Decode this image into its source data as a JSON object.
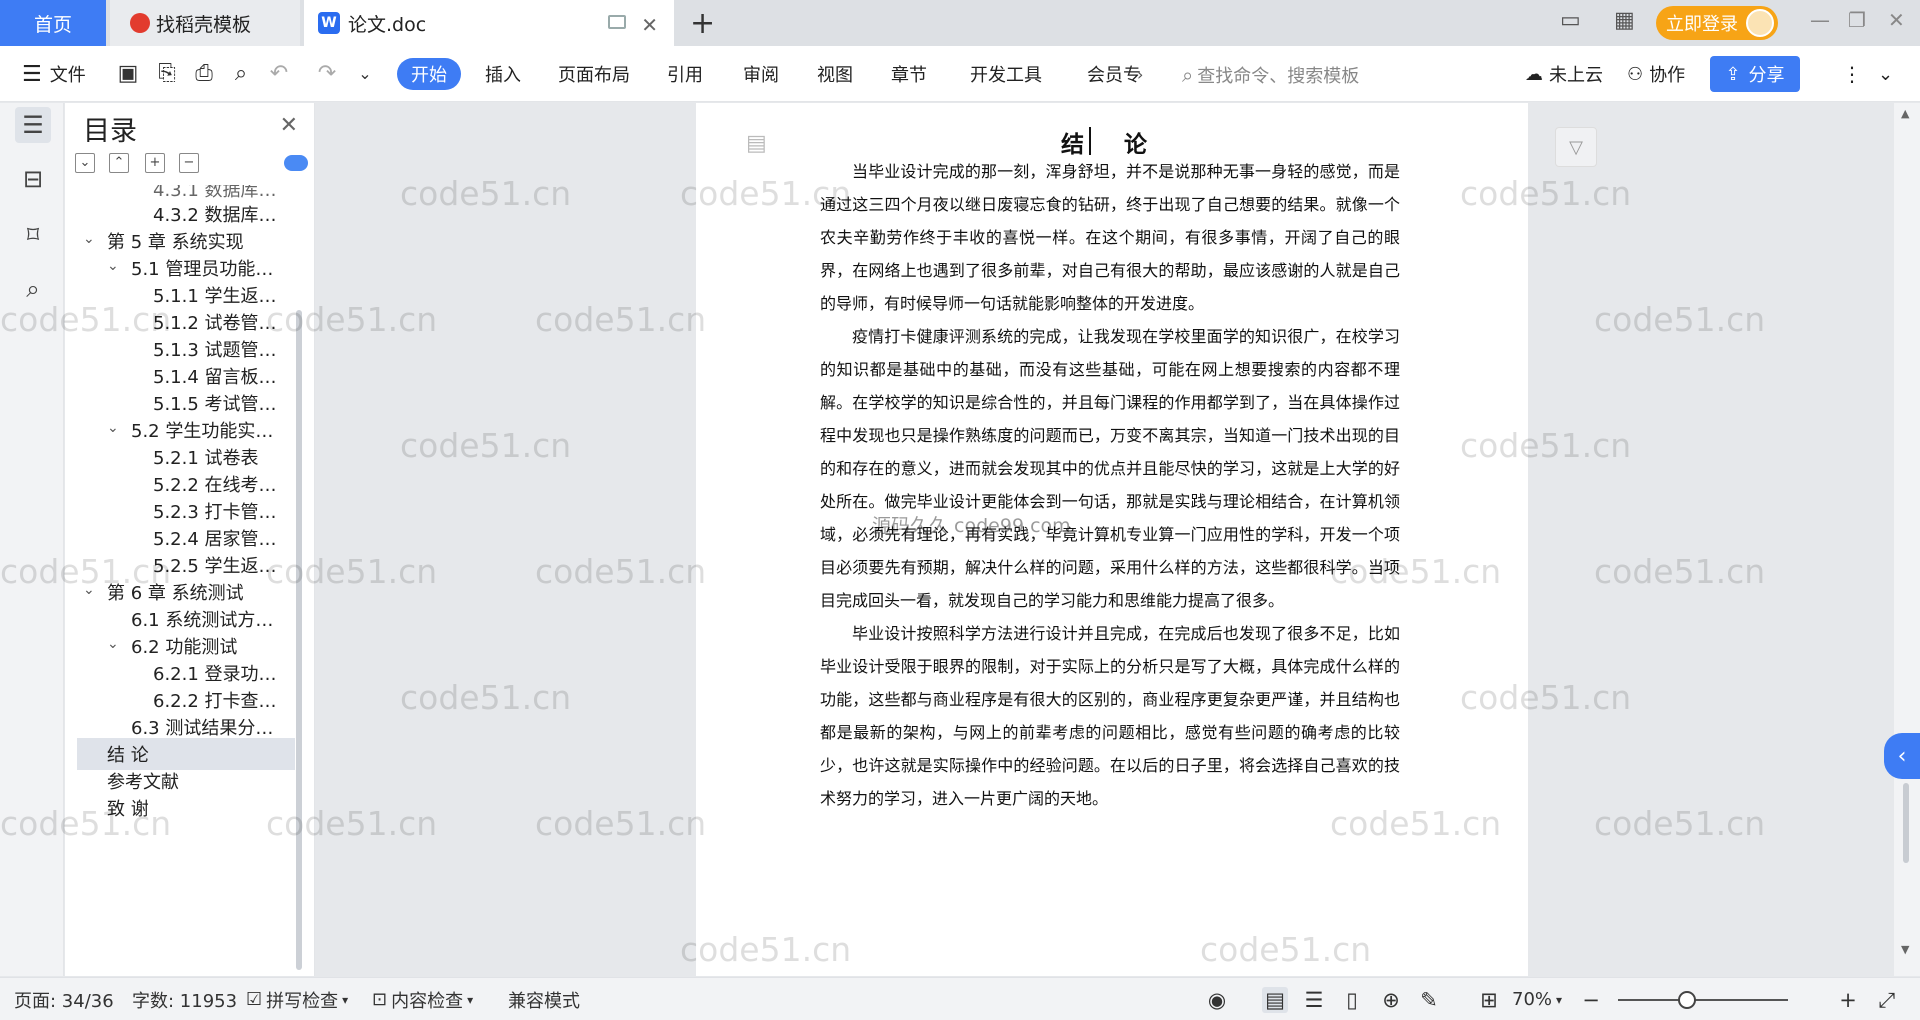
{
  "tabs": {
    "home": "首页",
    "daoke": "找稻壳模板",
    "doc": "论文.doc",
    "new_tab": "+"
  },
  "account": {
    "login": "立即登录"
  },
  "toolbar": {
    "file": "文件",
    "menus": [
      "开始",
      "插入",
      "页面布局",
      "引用",
      "审阅",
      "视图",
      "章节",
      "开发工具",
      "会员专"
    ],
    "search_placeholder": "查找命令、搜索模板",
    "cloud": "未上云",
    "collab": "协作",
    "share": "分享"
  },
  "toc": {
    "title": "目录",
    "items": [
      {
        "label": "4.3.1 数据库…"
      },
      {
        "label": "4.3.2 数据库…"
      },
      {
        "label": "第 5 章  系统实现"
      },
      {
        "label": "5.1 管理员功能…"
      },
      {
        "label": "5.1.1 学生返…"
      },
      {
        "label": "5.1.2 试卷管…"
      },
      {
        "label": "5.1.3 试题管…"
      },
      {
        "label": "5.1.4 留言板…"
      },
      {
        "label": "5.1.5 考试管…"
      },
      {
        "label": "5.2 学生功能实…"
      },
      {
        "label": "5.2.1 试卷表"
      },
      {
        "label": "5.2.2 在线考…"
      },
      {
        "label": "5.2.3 打卡管…"
      },
      {
        "label": "5.2.4 居家管…"
      },
      {
        "label": "5.2.5 学生返…"
      },
      {
        "label": "第 6 章  系统测试"
      },
      {
        "label": "6.1 系统测试方…"
      },
      {
        "label": "6.2 功能测试"
      },
      {
        "label": "6.2.1 登录功…"
      },
      {
        "label": "6.2.2 打卡查…"
      },
      {
        "label": "6.3 测试结果分…"
      },
      {
        "label": "结   论"
      },
      {
        "label": "参考文献"
      },
      {
        "label": "致   谢"
      }
    ]
  },
  "document": {
    "heading": "结 论",
    "paragraphs": [
      "当毕业设计完成的那一刻，浑身舒坦，并不是说那种无事一身轻的感觉，而是通过这三四个月夜以继日废寝忘食的钻研，终于出现了自己想要的结果。就像一个农夫辛勤劳作终于丰收的喜悦一样。在这个期间，有很多事情，开阔了自己的眼界，在网络上也遇到了很多前辈，对自己有很大的帮助，最应该感谢的人就是自己的导师，有时候导师一句话就能影响整体的开发进度。",
      "疫情打卡健康评测系统的完成，让我发现在学校里面学的知识很广，在校学习的知识都是基础中的基础，而没有这些基础，可能在网上想要搜索的内容都不理解。在学校学的知识是综合性的，并且每门课程的作用都学到了，当在具体操作过程中发现也只是操作熟练度的问题而已，万变不离其宗，当知道一门技术出现的目的和存在的意义，进而就会发现其中的优点并且能尽快的学习，这就是上大学的好处所在。做完毕业设计更能体会到一句话，那就是实践与理论相结合，在计算机领域，必须先有理论，再有实践，毕竟计算机专业算一门应用性的学科，开发一个项目必须要先有预期，解决什么样的问题，采用什么样的方法，这些都很科学。当项目完成回头一看，就发现自己的学习能力和思维能力提高了很多。",
      "毕业设计按照科学方法进行设计并且完成，在完成后也发现了很多不足，比如毕业设计受限于眼界的限制，对于实际上的分析只是写了大概，具体完成什么样的功能，这些都与商业程序是有很大的区别的，商业程序更复杂更严谨，并且结构也都是最新的架构，与网上的前辈考虑的问题相比，感觉有些问题的确考虑的比较少，也许这就是实际操作中的经验问题。在以后的日子里，将会选择自己喜欢的技术努力的学习，进入一片更广阔的天地。"
    ],
    "watermark_center": "源码久久 code99.com",
    "watermark": "code51.cn"
  },
  "status": {
    "page": "页面: 34/36",
    "words": "字数: 11953",
    "spell": "拼写检查",
    "content_check": "内容检查",
    "compat": "兼容模式",
    "zoom": "70%"
  }
}
